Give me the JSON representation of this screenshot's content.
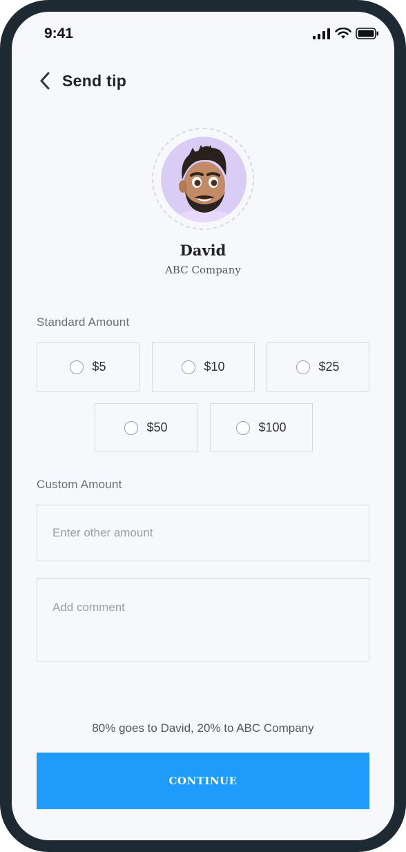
{
  "status_bar": {
    "time": "9:41"
  },
  "header": {
    "title": "Send tip"
  },
  "profile": {
    "name": "David",
    "company": "ABC Company"
  },
  "standard": {
    "label": "Standard Amount",
    "options": [
      "$5",
      "$10",
      "$25",
      "$50",
      "$100"
    ]
  },
  "custom": {
    "label": "Custom Amount",
    "amount_placeholder": "Enter other amount",
    "comment_placeholder": "Add comment"
  },
  "split_note": "80% goes to David, 20% to ABC Company",
  "continue_label": "CONTINUE",
  "colors": {
    "accent": "#1e9bfb",
    "frame": "#1d2a33",
    "screen_bg": "#f7f8fc"
  }
}
